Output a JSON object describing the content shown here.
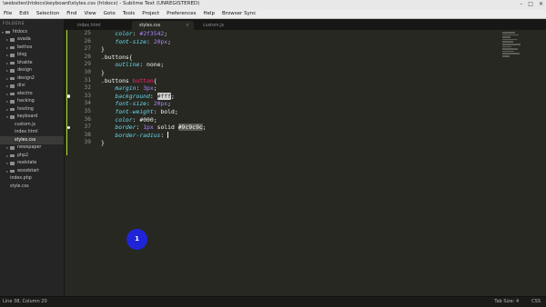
{
  "window": {
    "title": "\\websites\\htdocs\\keyboard\\styles.css (htdocs) - Sublime Text (UNREGISTERED)",
    "controls": [
      "–",
      "□",
      "✕"
    ]
  },
  "menu": [
    "File",
    "Edit",
    "Selection",
    "Find",
    "View",
    "Goto",
    "Tools",
    "Project",
    "Preferences",
    "Help",
    "Browser Sync"
  ],
  "sidebar": {
    "header": "FOLDERS",
    "items": [
      {
        "label": "htdocs",
        "type": "folder",
        "open": true
      },
      {
        "label": "avada",
        "type": "folder"
      },
      {
        "label": "bethos",
        "type": "folder"
      },
      {
        "label": "blog",
        "type": "folder"
      },
      {
        "label": "bhakte",
        "type": "folder"
      },
      {
        "label": "design",
        "type": "folder"
      },
      {
        "label": "design2",
        "type": "folder"
      },
      {
        "label": "divi",
        "type": "folder"
      },
      {
        "label": "electro",
        "type": "folder"
      },
      {
        "label": "hacking",
        "type": "folder"
      },
      {
        "label": "hosting",
        "type": "folder"
      },
      {
        "label": "keyboard",
        "type": "folder",
        "open": true
      },
      {
        "label": "custom.js",
        "type": "file"
      },
      {
        "label": "index.html",
        "type": "file"
      },
      {
        "label": "styles.css",
        "type": "file",
        "active": true
      },
      {
        "label": "newspaper",
        "type": "folder"
      },
      {
        "label": "php2",
        "type": "folder"
      },
      {
        "label": "realstate",
        "type": "folder"
      },
      {
        "label": "woodstart",
        "type": "folder"
      },
      {
        "label": "index.php",
        "type": "file"
      },
      {
        "label": "style.css",
        "type": "file"
      }
    ]
  },
  "tabs": [
    {
      "label": "index.html",
      "active": false
    },
    {
      "label": "styles.css",
      "active": true
    },
    {
      "label": "custom.js",
      "active": false
    }
  ],
  "editor": {
    "line_numbers": [
      "25",
      "26",
      "27",
      "28",
      "29",
      "30",
      "31",
      "32",
      "33",
      "34",
      "35",
      "36",
      "37",
      "38",
      "39"
    ],
    "code": {
      "l25": {
        "prop": "color",
        "val": "#2f3542"
      },
      "l26": {
        "prop": "font-size",
        "val": "20px"
      },
      "l27": {
        "text": "}"
      },
      "l28": {
        "text": ".buttons{"
      },
      "l29": {
        "prop": "outline",
        "val": "none"
      },
      "l30": {
        "text": "}"
      },
      "l31": {
        "selector": ".buttons",
        "tag": "button",
        "brace": "{"
      },
      "l32": {
        "prop": "margin",
        "val": "3px"
      },
      "l33": {
        "prop": "background",
        "val": "#fff"
      },
      "l34": {
        "prop": "font-size",
        "val": "20px"
      },
      "l35": {
        "prop": "font-weight",
        "val": "bold"
      },
      "l36": {
        "prop": "color",
        "val": "#000"
      },
      "l37": {
        "prop": "border",
        "val1": "1px",
        "val2": "solid",
        "val3": "#9c9c9c"
      },
      "l38": {
        "prop": "border-radius"
      },
      "l39": {
        "text": "}"
      }
    }
  },
  "click_indicator": {
    "label": "1"
  },
  "status": {
    "position": "Line 38, Column 20",
    "tab_size": "Tab Size: 4",
    "syntax": "CSS"
  }
}
